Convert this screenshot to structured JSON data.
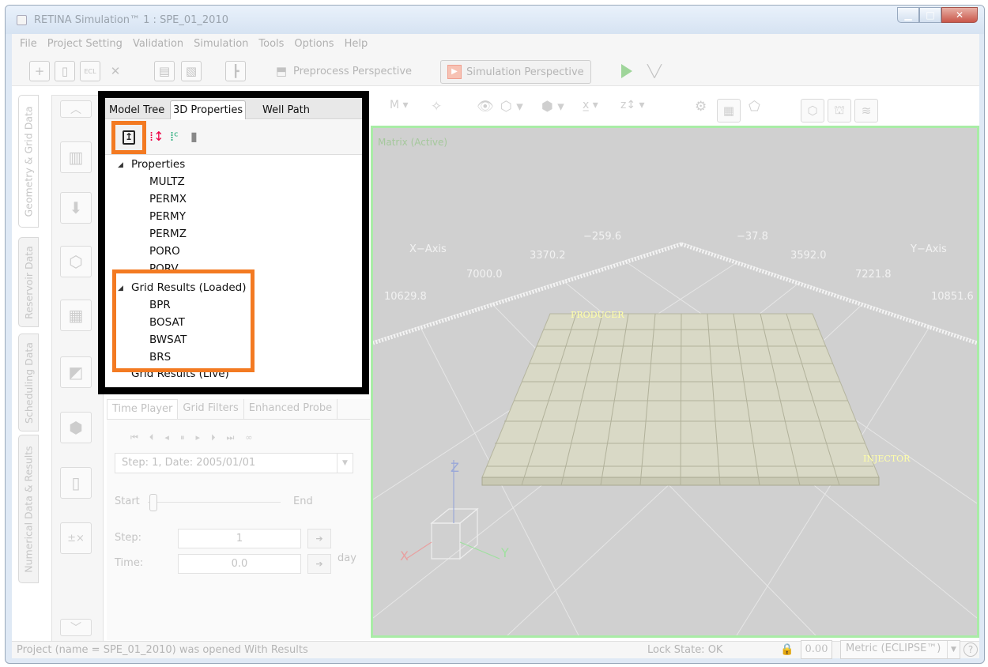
{
  "window": {
    "title": "RETINA Simulation™ 1 : SPE_01_2010"
  },
  "menu": [
    "File",
    "Project Setting",
    "Validation",
    "Simulation",
    "Tools",
    "Options",
    "Help"
  ],
  "toolbar": {
    "preprocess_label": "Preprocess Perspective",
    "simulation_label": "Simulation Perspective"
  },
  "vertical_tabs": [
    "Geometry & Grid Data",
    "Reservoir Data",
    "Scheduling Data",
    "Numerical Data & Results"
  ],
  "tree_panel": {
    "tabs": [
      "Model Tree",
      "3D Properties",
      "Well Path"
    ],
    "properties_label": "Properties",
    "properties": [
      "MULTZ",
      "PERMX",
      "PERMY",
      "PERMZ",
      "PORO",
      "PORV"
    ],
    "loaded_label": "Grid Results (Loaded)",
    "loaded": [
      "BPR",
      "BOSAT",
      "BWSAT",
      "BRS"
    ],
    "live_label": "Grid Results (Live)"
  },
  "player_panel": {
    "tabs": [
      "Time Player",
      "Grid Filters",
      "Enhanced Probe"
    ],
    "step_select": "Step: 1, Date: 2005/01/01",
    "start_label": "Start",
    "end_label": "End",
    "step_label": "Step:",
    "step_value": "1",
    "time_label": "Time:",
    "time_value": "0.0",
    "time_unit": "day"
  },
  "viewport": {
    "title": "Matrix (Active)",
    "x_axis_label": "X−Axis",
    "y_axis_label": "Y−Axis",
    "z_axis_label": "Z",
    "x_ticks": [
      "10629.8",
      "7000.0",
      "3370.2",
      "−259.6"
    ],
    "y_ticks": [
      "−37.8",
      "3592.0",
      "7221.8",
      "10851.6"
    ],
    "wells": [
      "PRODUCER",
      "INJECTOR"
    ],
    "cube_axes": [
      "X",
      "Y",
      "Z"
    ]
  },
  "status": {
    "message": "Project (name = SPE_01_2010) was opened With Results",
    "lock_state": "Lock State: OK",
    "value": "0.00",
    "units": "Metric (ECLIPSE™)",
    "help": "?"
  },
  "colors": {
    "highlight": "#f37a22",
    "viewport_border": "#a9eca6",
    "viewport_bg": "#d0d0d0",
    "grid_fill": "#d8d8c4"
  }
}
